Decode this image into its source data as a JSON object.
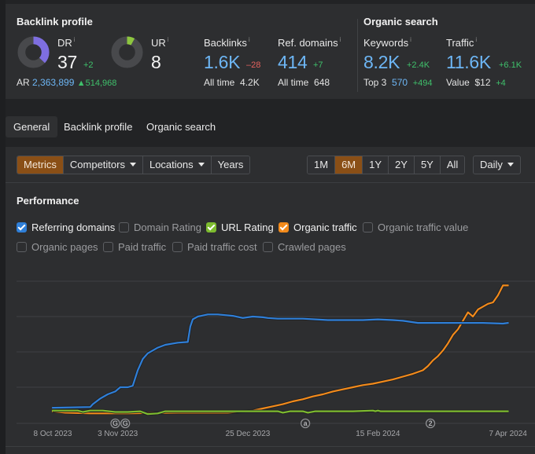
{
  "backlink_profile": {
    "title": "Backlink profile",
    "dr": {
      "label": "DR",
      "info": "i",
      "value": "37",
      "delta": "+2",
      "fraction": 0.37,
      "color": "#7e6ee0"
    },
    "ur": {
      "label": "UR",
      "info": "i",
      "value": "8",
      "fraction": 0.08,
      "color": "#8dc63f"
    },
    "ar": {
      "label": "AR",
      "value": "2,363,899",
      "delta": "514,968",
      "delta_icon": "triangle-up"
    },
    "backlinks": {
      "label": "Backlinks",
      "info": "i",
      "value": "1.6K",
      "delta": "‒28",
      "sub_label": "All time",
      "sub_value": "4.2K"
    },
    "ref_domains": {
      "label": "Ref. domains",
      "info": "i",
      "value": "414",
      "delta": "+7",
      "sub_label": "All time",
      "sub_value": "648"
    }
  },
  "organic_search": {
    "title": "Organic search",
    "keywords": {
      "label": "Keywords",
      "info": "i",
      "value": "8.2K",
      "delta": "+2.4K",
      "sub_label": "Top 3",
      "sub_value": "570",
      "sub_delta": "+494"
    },
    "traffic": {
      "label": "Traffic",
      "info": "i",
      "value": "11.6K",
      "delta": "+6.1K",
      "sub_label": "Value",
      "sub_value": "$12",
      "sub_delta": "+4"
    }
  },
  "tabs": [
    {
      "label": "General",
      "active": true
    },
    {
      "label": "Backlink profile",
      "active": false
    },
    {
      "label": "Organic search",
      "active": false
    }
  ],
  "toolbar": {
    "view_buttons": [
      {
        "label": "Metrics",
        "active": true,
        "dropdown": false
      },
      {
        "label": "Competitors",
        "active": false,
        "dropdown": true
      },
      {
        "label": "Locations",
        "active": false,
        "dropdown": true
      },
      {
        "label": "Years",
        "active": false,
        "dropdown": false
      }
    ],
    "range_buttons": [
      {
        "label": "1M",
        "active": false
      },
      {
        "label": "6M",
        "active": true
      },
      {
        "label": "1Y",
        "active": false
      },
      {
        "label": "2Y",
        "active": false
      },
      {
        "label": "5Y",
        "active": false
      },
      {
        "label": "All",
        "active": false
      }
    ],
    "interval": {
      "label": "Daily"
    }
  },
  "performance": {
    "title": "Performance",
    "checkboxes": [
      {
        "label": "Referring domains",
        "checked": true,
        "color": "#2f7fd8"
      },
      {
        "label": "Domain Rating",
        "checked": false
      },
      {
        "label": "URL Rating",
        "checked": true,
        "color": "#7dbb2f"
      },
      {
        "label": "Organic traffic",
        "checked": true,
        "color": "#f28a1b"
      },
      {
        "label": "Organic traffic value",
        "checked": false
      },
      {
        "label": "Organic pages",
        "checked": false
      },
      {
        "label": "Paid traffic",
        "checked": false
      },
      {
        "label": "Paid traffic cost",
        "checked": false
      },
      {
        "label": "Crawled pages",
        "checked": false
      }
    ]
  },
  "chart_data": {
    "type": "line",
    "title": "Performance",
    "xlabel": "",
    "ylabel": "",
    "x_range": [
      "2023-10-08",
      "2024-04-09"
    ],
    "x_ticks": [
      "8 Oct 2023",
      "3 Nov 2023",
      "25 Dec 2023",
      "15 Feb 2024",
      "7 Apr 2024"
    ],
    "x_tick_days": [
      0,
      26,
      78,
      130,
      182
    ],
    "y_range": [
      0,
      100
    ],
    "y_gridlines": [
      0,
      25,
      50,
      75,
      100
    ],
    "y_tick_labels_visible": false,
    "grid": true,
    "legend": "checkbox row above chart",
    "annotations": [
      {
        "day": 25,
        "label": "G"
      },
      {
        "day": 29,
        "label": "G"
      },
      {
        "day": 101,
        "label": "a"
      },
      {
        "day": 151,
        "label": "2"
      }
    ],
    "series": [
      {
        "name": "Referring domains",
        "color": "#2f7fd8",
        "x_days": [
          0,
          15,
          16,
          19,
          22,
          25,
          27,
          30,
          32,
          34,
          36,
          38,
          40,
          42,
          45,
          50,
          54,
          55,
          56,
          58,
          62,
          66,
          72,
          76,
          80,
          84,
          86,
          90,
          100,
          110,
          116,
          124,
          130,
          136,
          140,
          146,
          152,
          158,
          164,
          172,
          180,
          182
        ],
        "values": [
          10.5,
          11,
          13,
          17,
          20,
          22,
          25,
          25,
          26,
          37,
          45,
          49,
          51,
          53,
          55,
          56.5,
          57,
          68,
          73,
          75,
          76.5,
          76.5,
          75.5,
          74,
          75,
          74.5,
          74,
          73.5,
          73.5,
          72.5,
          72.5,
          72.5,
          73,
          72.5,
          72,
          70.5,
          70.5,
          70.5,
          70.5,
          70.5,
          70,
          70.5
        ]
      },
      {
        "name": "URL Rating",
        "color": "#7dbb2f",
        "x_days": [
          0,
          10,
          12,
          15,
          20,
          25,
          30,
          35,
          38,
          42,
          45,
          50,
          60,
          70,
          80,
          90,
          92,
          95,
          100,
          102,
          105,
          120,
          128,
          129,
          130,
          131,
          132,
          140,
          160,
          182
        ],
        "values": [
          8.5,
          8.5,
          7.5,
          8.5,
          8.5,
          7.5,
          7.5,
          8,
          6,
          6.5,
          8,
          8,
          8,
          8,
          8,
          8,
          7,
          8,
          8,
          7,
          8,
          8,
          8.5,
          8,
          8.5,
          8,
          8,
          8,
          8,
          8
        ]
      },
      {
        "name": "Organic traffic",
        "color": "#f28a1b",
        "x_days": [
          0,
          5,
          15,
          30,
          50,
          70,
          80,
          84,
          88,
          92,
          96,
          100,
          104,
          108,
          112,
          116,
          120,
          124,
          128,
          132,
          136,
          140,
          144,
          148,
          150,
          152,
          154,
          156,
          158,
          160,
          162,
          164,
          166,
          168,
          170,
          172,
          174,
          176,
          178,
          180,
          182
        ],
        "values": [
          8,
          7,
          6.5,
          6.5,
          7,
          7,
          8.5,
          10,
          11.5,
          13,
          15,
          16.5,
          18.5,
          20,
          22,
          23.5,
          25,
          26.5,
          27.5,
          29,
          30.5,
          32.5,
          34.5,
          37,
          40,
          44,
          47,
          51,
          56,
          62,
          66,
          72,
          78,
          75,
          80,
          82,
          84,
          85,
          90,
          97,
          97
        ]
      }
    ]
  }
}
